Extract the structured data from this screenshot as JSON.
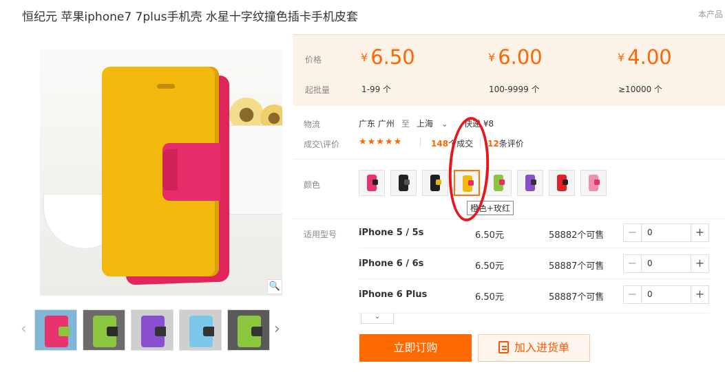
{
  "title": "恒纪元 苹果iphone7 7plus手机壳 水星十字纹撞色插卡手机皮套",
  "top_right_note": "本产品",
  "price_table": {
    "price_label": "价格",
    "qty_label": "起批量",
    "tiers": [
      {
        "currency": "¥",
        "price": "6.50",
        "range": "1-99 个"
      },
      {
        "currency": "¥",
        "price": "6.00",
        "range": "100-9999 个"
      },
      {
        "currency": "¥",
        "price": "4.00",
        "range": "≥10000 个"
      }
    ]
  },
  "logistics": {
    "label": "物流",
    "from": "广东 广州",
    "to_word": "至",
    "to": "上海",
    "express": "快递 ¥8"
  },
  "deals": {
    "label": "成交\\评价",
    "stars": "★★★★★",
    "deal_count": "148",
    "deal_suffix": "个成交",
    "review_count": "12",
    "review_suffix": "条评价"
  },
  "colors": {
    "label": "颜色",
    "tooltip": "橙色+玫红",
    "swatches": [
      {
        "case": "#e8336f",
        "strap": "#222222"
      },
      {
        "case": "#222222",
        "strap": "#555555"
      },
      {
        "case": "#1f1f1f",
        "strap": "#e8b40a"
      },
      {
        "case": "#f2b90c",
        "strap": "#e62d6a"
      },
      {
        "case": "#8cc63f",
        "strap": "#e62d6a"
      },
      {
        "case": "#8a4fd0",
        "strap": "#333333"
      },
      {
        "case": "#e0202a",
        "strap": "#222222"
      },
      {
        "case": "#f08eb0",
        "strap": "#e8336f"
      }
    ]
  },
  "models": {
    "label": "适用型号",
    "rows": [
      {
        "name": "iPhone 5 / 5s",
        "price": "6.50元",
        "stock": "58882个可售",
        "qty": "0"
      },
      {
        "name": "iPhone 6 / 6s",
        "price": "6.50元",
        "stock": "58887个可售",
        "qty": "0"
      },
      {
        "name": "iPhone 6 Plus",
        "price": "6.50元",
        "stock": "58887个可售",
        "qty": "0"
      }
    ]
  },
  "actions": {
    "buy": "立即订购",
    "cart": "加入进货单"
  },
  "icons": {
    "zoom": "🔍",
    "prev": "‹",
    "next": "›",
    "dropdown": "⌄",
    "more": "⌄",
    "minus": "−",
    "plus": "+"
  },
  "thumbnails": [
    {
      "bg": "#7fb7d8",
      "case": "#e8336f",
      "strap": "#8cc63f"
    },
    {
      "bg": "#6b6b6b",
      "case": "#8cc63f",
      "strap": "#2a2a2a"
    },
    {
      "bg": "#cfcfcf",
      "case": "#8a4fd0",
      "strap": "#333333"
    },
    {
      "bg": "#cfcfcf",
      "case": "#7cc8ea",
      "strap": "#333333"
    },
    {
      "bg": "#5a5a5a",
      "case": "#8cc63f",
      "strap": "#333333"
    }
  ]
}
